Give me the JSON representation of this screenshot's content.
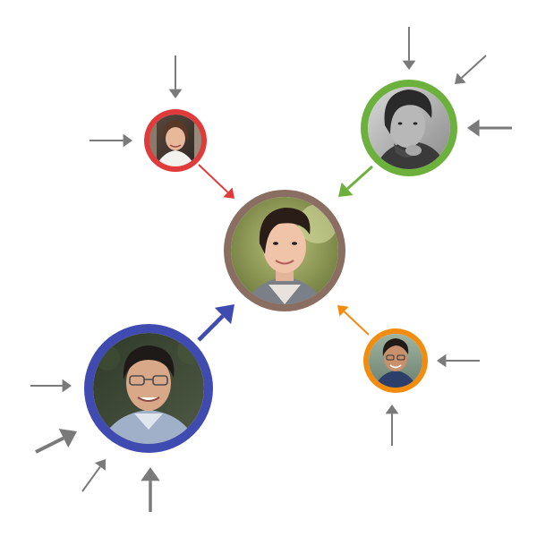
{
  "diagram": {
    "description_type": "influence-network",
    "colors": {
      "center_ring": "#8b6e62",
      "red_ring": "#e03a3a",
      "green_ring": "#6cb13c",
      "blue_ring": "#3f4bb0",
      "orange_ring": "#f28c0f",
      "external_arrow": "#7a7a7a"
    },
    "nodes": [
      {
        "id": "center",
        "role": "center",
        "ring_color": "#8b6e62"
      },
      {
        "id": "red",
        "role": "source",
        "ring_color": "#e03a3a",
        "incoming_external": 2
      },
      {
        "id": "green",
        "role": "source",
        "ring_color": "#6cb13c",
        "incoming_external": 3
      },
      {
        "id": "blue",
        "role": "source",
        "ring_color": "#3f4bb0",
        "incoming_external": 4
      },
      {
        "id": "orange",
        "role": "source",
        "ring_color": "#f28c0f",
        "incoming_external": 2
      }
    ],
    "edges": [
      {
        "from": "red",
        "to": "center",
        "color": "#e03a3a",
        "weight": "thin"
      },
      {
        "from": "green",
        "to": "center",
        "color": "#6cb13c",
        "weight": "medium"
      },
      {
        "from": "blue",
        "to": "center",
        "color": "#3f4bb0",
        "weight": "thick"
      },
      {
        "from": "orange",
        "to": "center",
        "color": "#f28c0f",
        "weight": "thin"
      }
    ]
  }
}
